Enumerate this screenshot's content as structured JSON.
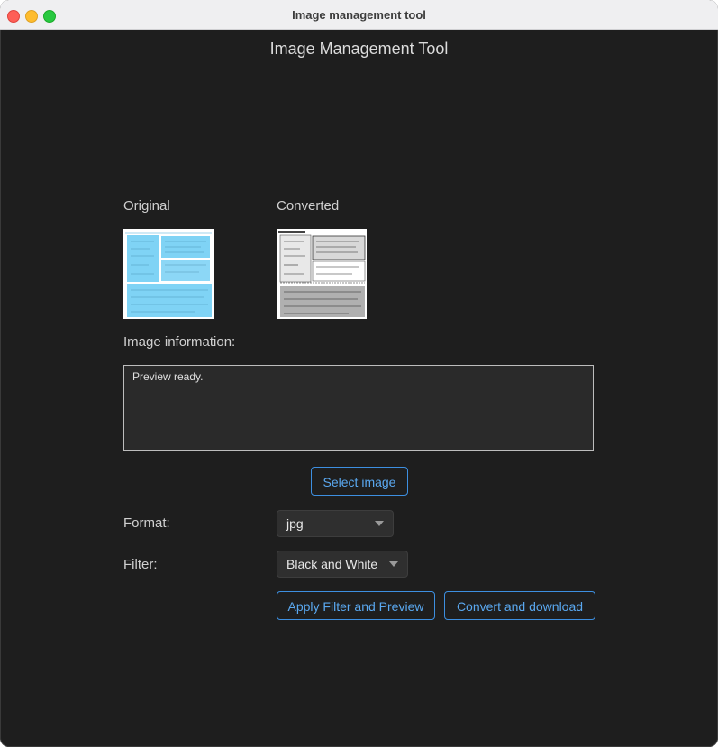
{
  "window": {
    "title": "Image management tool"
  },
  "app": {
    "title": "Image Management Tool"
  },
  "labels": {
    "original": "Original",
    "converted": "Converted",
    "image_information": "Image information:",
    "format": "Format:",
    "filter": "Filter:"
  },
  "info": {
    "text": "Preview ready."
  },
  "buttons": {
    "select_image": "Select image",
    "apply_filter": "Apply Filter and Preview",
    "convert_download": "Convert and download"
  },
  "selects": {
    "format": {
      "value": "jpg",
      "icon": "chevron-down-icon"
    },
    "filter": {
      "value": "Black and White",
      "icon": "chevron-down-icon"
    }
  },
  "colors": {
    "window_bg": "#1e1e1e",
    "accent": "#3d8fe0",
    "accent_text": "#5aa8f0",
    "original_thumb_fill": "#7fd3f5",
    "converted_thumb_fill": "#b0b0b0"
  }
}
